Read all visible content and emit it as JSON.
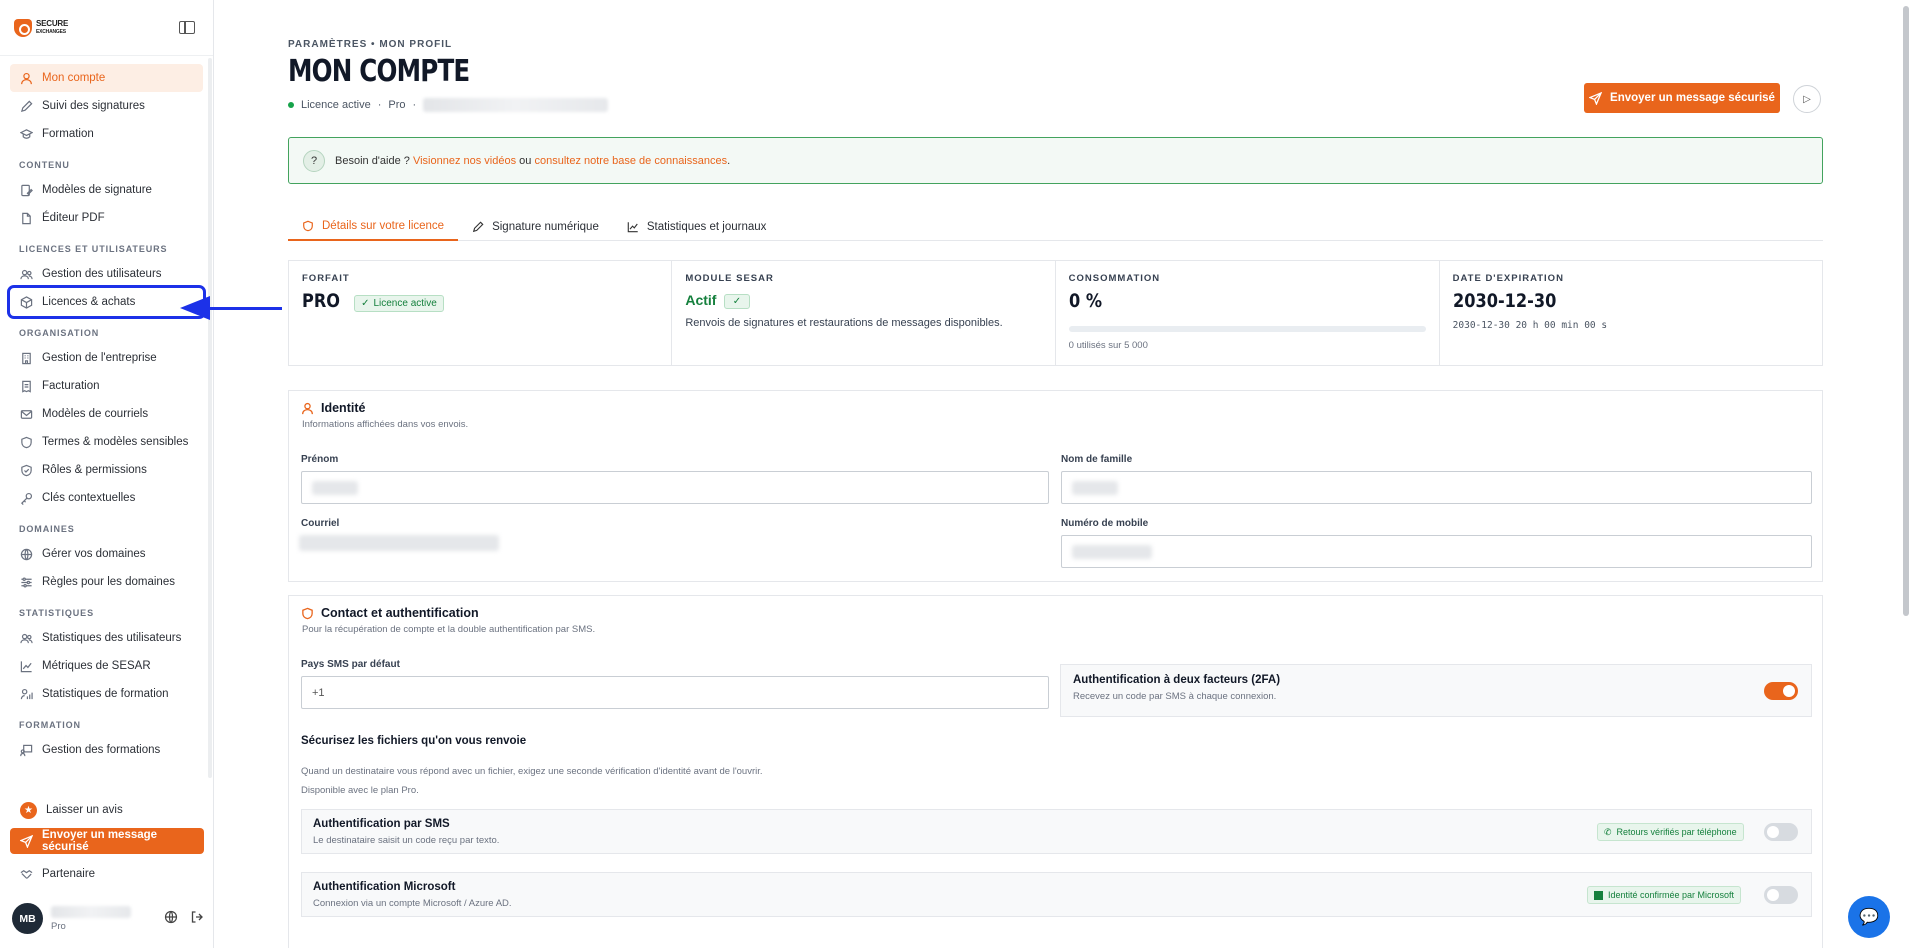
{
  "sidebar": {
    "logo_text_top": "SECURE",
    "logo_text_bottom": "EXCHANGES",
    "top_items": [
      {
        "label": "Mon compte"
      },
      {
        "label": "Suivi des signatures"
      },
      {
        "label": "Formation"
      }
    ],
    "sections": {
      "contenu": "CONTENU",
      "licences": "LICENCES ET UTILISATEURS",
      "organisation": "ORGANISATION",
      "domaines": "DOMAINES",
      "statistiques": "STATISTIQUES",
      "formation": "FORMATION"
    },
    "contenu_items": [
      {
        "label": "Modèles de signature"
      },
      {
        "label": "Éditeur PDF"
      }
    ],
    "licences_items": [
      {
        "label": "Gestion des utilisateurs"
      },
      {
        "label": "Licences & achats"
      }
    ],
    "organisation_items": [
      {
        "label": "Gestion de l'entreprise"
      },
      {
        "label": "Facturation"
      },
      {
        "label": "Modèles de courriels"
      },
      {
        "label": "Termes & modèles sensibles"
      },
      {
        "label": "Rôles & permissions"
      },
      {
        "label": "Clés contextuelles"
      }
    ],
    "domaines_items": [
      {
        "label": "Gérer vos domaines"
      },
      {
        "label": "Règles pour les domaines"
      }
    ],
    "statistiques_items": [
      {
        "label": "Statistiques des utilisateurs"
      },
      {
        "label": "Métriques de SESAR"
      },
      {
        "label": "Statistiques de formation"
      }
    ],
    "formation_items": [
      {
        "label": "Gestion des formations"
      }
    ],
    "bottom": {
      "review": "Laisser un avis",
      "send": "Envoyer un message sécurisé",
      "partner": "Partenaire"
    },
    "user": {
      "initials": "MB",
      "plan": "Pro"
    }
  },
  "header": {
    "breadcrumb": "PARAMÈTRES • MON PROFIL",
    "title": "MON COMPTE",
    "license_status": "Licence active",
    "separator": "·",
    "plan": "Pro",
    "send_button": "Envoyer un message sécurisé"
  },
  "help": {
    "prefix": "Besoin d'aide ?",
    "videos_link": "Visionnez nos vidéos",
    "middle": "ou",
    "kb_link": "consultez notre base de connaissances",
    "suffix": "."
  },
  "tabs": [
    {
      "label": "Détails sur votre licence"
    },
    {
      "label": "Signature numérique"
    },
    {
      "label": "Statistiques et journaux"
    }
  ],
  "stats": {
    "forfait_label": "FORFAIT",
    "forfait_value": "PRO",
    "forfait_badge": "Licence active",
    "sesar_label": "MODULE SESAR",
    "sesar_value": "Actif",
    "sesar_text": "Renvois de signatures et restaurations de messages disponibles.",
    "conso_label": "CONSOMMATION",
    "conso_value": "0 %",
    "conso_progress": 0,
    "conso_text": "0 utilisés sur 5 000",
    "exp_label": "DATE D'EXPIRATION",
    "exp_value": "2030-12-30",
    "exp_countdown": "2030-12-30 20 h 00 min 00 s"
  },
  "identity": {
    "title": "Identité",
    "subtitle": "Informations affichées dans vos envois.",
    "firstname_label": "Prénom",
    "lastname_label": "Nom de famille",
    "email_label": "Courriel",
    "mobile_label": "Numéro de mobile"
  },
  "contact": {
    "title": "Contact et authentification",
    "subtitle": "Pour la récupération de compte et la double authentification par SMS.",
    "sms_country_label": "Pays SMS par défaut",
    "sms_country_value": "+1",
    "twofa_title": "Authentification à deux facteurs (2FA)",
    "twofa_sub": "Recevez un code par SMS à chaque connexion.",
    "twofa_enabled": true,
    "secure_files_title": "Sécurisez les fichiers qu'on vous renvoie",
    "secure_files_text": "Quand un destinataire vous répond avec un fichier, exigez une seconde vérification d'identité avant de l'ouvrir.",
    "secure_files_plan": "Disponible avec le plan Pro.",
    "sms_auth_title": "Authentification par SMS",
    "sms_auth_sub": "Le destinataire saisit un code reçu par texto.",
    "sms_auth_pill": "Retours vérifiés par téléphone",
    "ms_auth_title": "Authentification Microsoft",
    "ms_auth_sub": "Connexion via un compte Microsoft / Azure AD.",
    "ms_auth_pill": "Identité confirmée par Microsoft"
  },
  "colors": {
    "accent": "#e9651c",
    "annotation": "#1c31e8",
    "success": "#15803d"
  }
}
